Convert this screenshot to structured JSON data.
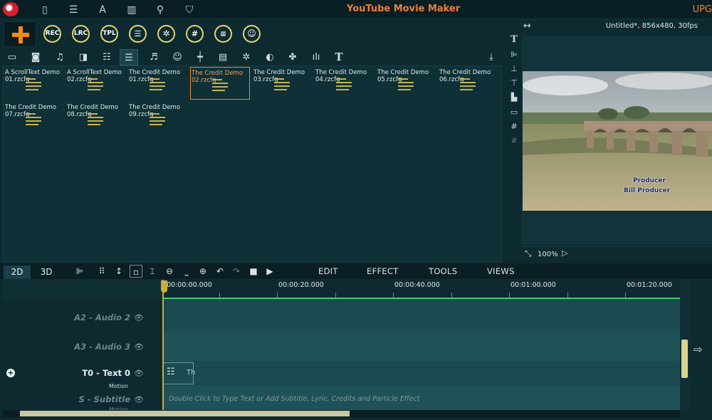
{
  "app": {
    "title": "YouTube Movie Maker",
    "upgrade_label": "UPG"
  },
  "toolbar": {
    "buttons": [
      {
        "name": "rec-button",
        "label": "REC"
      },
      {
        "name": "lrc-button",
        "label": "LRC"
      },
      {
        "name": "tpl-button",
        "label": "TPL"
      }
    ]
  },
  "library": {
    "tiles": [
      {
        "label": "A ScrollText Demo\n01.rzcfg"
      },
      {
        "label": "A ScrollText Demo\n02.rzcfg"
      },
      {
        "label": "The Credit Demo\n01.rzcfg"
      },
      {
        "label": "The Credit Demo\n02.rzcfg"
      },
      {
        "label": "The Credit Demo\n03.rzcfg"
      },
      {
        "label": "The Credit Demo\n04.rzcfg"
      },
      {
        "label": "The Credit Demo\n05.rzcfg"
      },
      {
        "label": "The Credit Demo\n06.rzcfg"
      },
      {
        "label": "The Credit Demo\n07.rzcfg"
      },
      {
        "label": "The Credit Demo\n08.rzcfg"
      },
      {
        "label": "The Credit Demo\n09.rzcfg"
      }
    ],
    "selected_index": 3
  },
  "preview": {
    "info": "Untitled*, 856x480, 30fps",
    "zoom": "100%",
    "credit_title": "Producer",
    "credit_name": "Bill Producer"
  },
  "timeline": {
    "modes": [
      "2D",
      "3D"
    ],
    "active_mode": "2D",
    "menus": [
      "EDIT",
      "EFFECT",
      "TOOLS",
      "VIEWS"
    ],
    "ruler_labels": [
      "00:00:00.000",
      "00:00:20.000",
      "00:00:40.000",
      "00:01:00.000",
      "00:01:20.000"
    ],
    "tracks": [
      {
        "name": "A2 - Audio 2"
      },
      {
        "name": "A3 - Audio 3"
      },
      {
        "name": "T0 - Text 0",
        "sub": "Motion"
      },
      {
        "name": "S - Subtitle",
        "sub": "Motion"
      }
    ],
    "clip_text": "Th",
    "hint": "Double Click to Type Text or Add Subtitle, Lyric, Credits and Particle Effect"
  }
}
